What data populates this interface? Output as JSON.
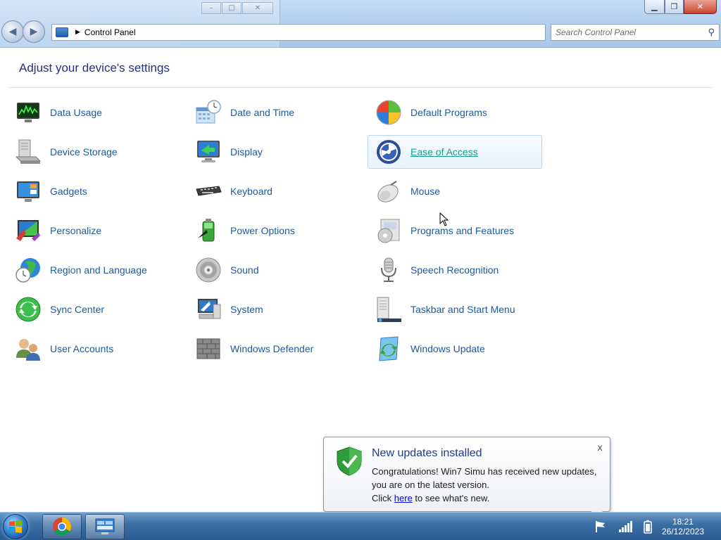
{
  "window": {
    "address_path": "Control Panel",
    "search_placeholder": "Search Control Panel"
  },
  "content": {
    "title": "Adjust your device's settings",
    "items": [
      {
        "label": "Data Usage",
        "icon": "monitor-graph-icon"
      },
      {
        "label": "Date and Time",
        "icon": "calendar-clock-icon"
      },
      {
        "label": "Default Programs",
        "icon": "windows-flag-icon"
      },
      {
        "label": "Device Storage",
        "icon": "hard-drive-icon"
      },
      {
        "label": "Display",
        "icon": "display-icon"
      },
      {
        "label": "Ease of Access",
        "icon": "accessibility-icon"
      },
      {
        "label": "Gadgets",
        "icon": "gadgets-icon"
      },
      {
        "label": "Keyboard",
        "icon": "keyboard-icon"
      },
      {
        "label": "Mouse",
        "icon": "mouse-icon"
      },
      {
        "label": "Personalize",
        "icon": "personalize-icon"
      },
      {
        "label": "Power Options",
        "icon": "battery-icon"
      },
      {
        "label": "Programs and Features",
        "icon": "programs-icon"
      },
      {
        "label": "Region and Language",
        "icon": "globe-clock-icon"
      },
      {
        "label": "Sound",
        "icon": "speaker-icon"
      },
      {
        "label": "Speech Recognition",
        "icon": "microphone-icon"
      },
      {
        "label": "Sync Center",
        "icon": "sync-icon"
      },
      {
        "label": "System",
        "icon": "system-icon"
      },
      {
        "label": "Taskbar and Start Menu",
        "icon": "taskbar-icon"
      },
      {
        "label": "User Accounts",
        "icon": "users-icon"
      },
      {
        "label": "Windows Defender",
        "icon": "wall-icon"
      },
      {
        "label": "Windows Update",
        "icon": "update-icon"
      }
    ]
  },
  "notification": {
    "title": "New updates installed",
    "line1": "Congratulations! Win7 Simu has received new updates, you are on the latest version.",
    "click_prefix": "Click ",
    "link_text": "here",
    "click_suffix": " to see what's new.",
    "close_label": "x"
  },
  "taskbar": {
    "time": "18:21",
    "date": "26/12/2023"
  },
  "colors": {
    "link": "#1e5a9a",
    "hover_link": "#1aa08a",
    "title": "#1e3287"
  }
}
